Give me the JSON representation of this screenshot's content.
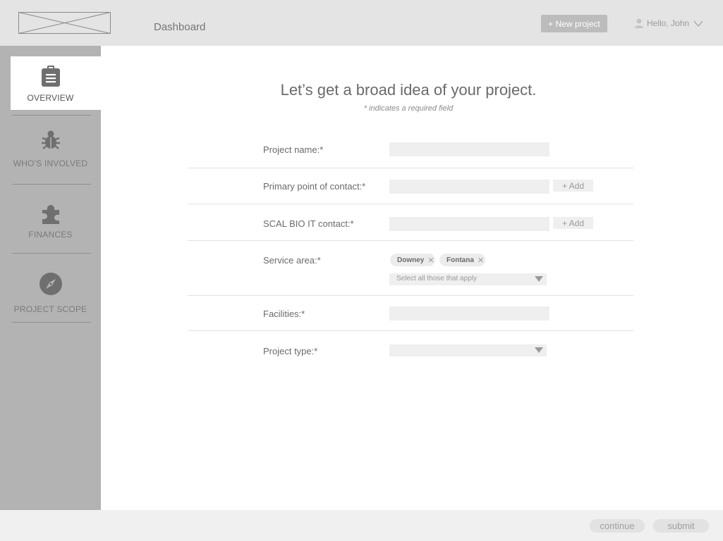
{
  "header": {
    "title": "Dashboard",
    "new_project_label": "+ New project",
    "greeting": "Hello, John",
    "icons": {
      "logo": "logo-placeholder",
      "user": "user-icon",
      "dropdown": "chevron-down-icon"
    }
  },
  "sidebar": {
    "items": [
      {
        "label": "OVERVIEW",
        "icon": "clipboard-icon",
        "active": true
      },
      {
        "label": "WHO'S INVOLVED",
        "icon": "bug-icon",
        "active": false
      },
      {
        "label": "FINANCES",
        "icon": "puzzle-icon",
        "active": false
      },
      {
        "label": "PROJECT SCOPE",
        "icon": "compass-icon",
        "active": false
      }
    ]
  },
  "main": {
    "title": "Let’s get a broad idea of your project.",
    "subtitle": "* indicates a required field",
    "fields": {
      "project_name": {
        "label": "Project name:*",
        "value": ""
      },
      "primary_contact": {
        "label": "Primary point of contact:*",
        "value": "",
        "add_label": "+ Add"
      },
      "it_contact": {
        "label": "SCAL BIO IT contact:*",
        "value": "",
        "add_label": "+ Add"
      },
      "service_area": {
        "label": "Service area:*",
        "chips": [
          "Downey",
          "Fontana"
        ],
        "placeholder": "Select all those that apply"
      },
      "facilities": {
        "label": "Facilities:*",
        "value": ""
      },
      "project_type": {
        "label": "Project type:*",
        "value": ""
      }
    }
  },
  "footer": {
    "continue_label": "continue",
    "submit_label": "submit"
  },
  "colors": {
    "topbar_bg": "#e4e4e4",
    "sidebar_bg": "#b3b3b3",
    "field_bg": "#efefef",
    "footer_bg": "#f0f0f0"
  }
}
